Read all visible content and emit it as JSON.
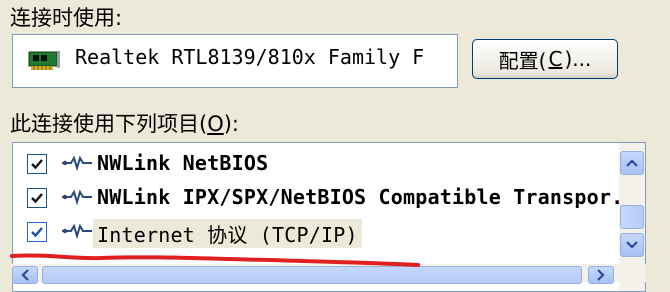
{
  "connect_using": {
    "label": "连接时使用:"
  },
  "adapter": {
    "name": "Realtek RTL8139/810x Family F",
    "icon": "network-card-icon"
  },
  "config_button": {
    "label_prefix": "配置(",
    "accel": "C",
    "label_suffix": ")..."
  },
  "items_label": {
    "prefix": "此连接使用下列项目(",
    "accel": "O",
    "suffix": "):"
  },
  "components": [
    {
      "label": "NWLink NetBIOS",
      "checked": true,
      "selected": false,
      "icon": "protocol-icon"
    },
    {
      "label": "NWLink IPX/SPX/NetBIOS Compatible Transpor.",
      "checked": true,
      "selected": false,
      "icon": "protocol-icon"
    },
    {
      "label": "Internet 协议 (TCP/IP)",
      "checked": true,
      "selected": true,
      "icon": "protocol-icon"
    }
  ],
  "colors": {
    "dialog_bg": "#ece9d8",
    "border": "#7f9db9",
    "check": "#21a121",
    "annotation": "#e02020"
  }
}
